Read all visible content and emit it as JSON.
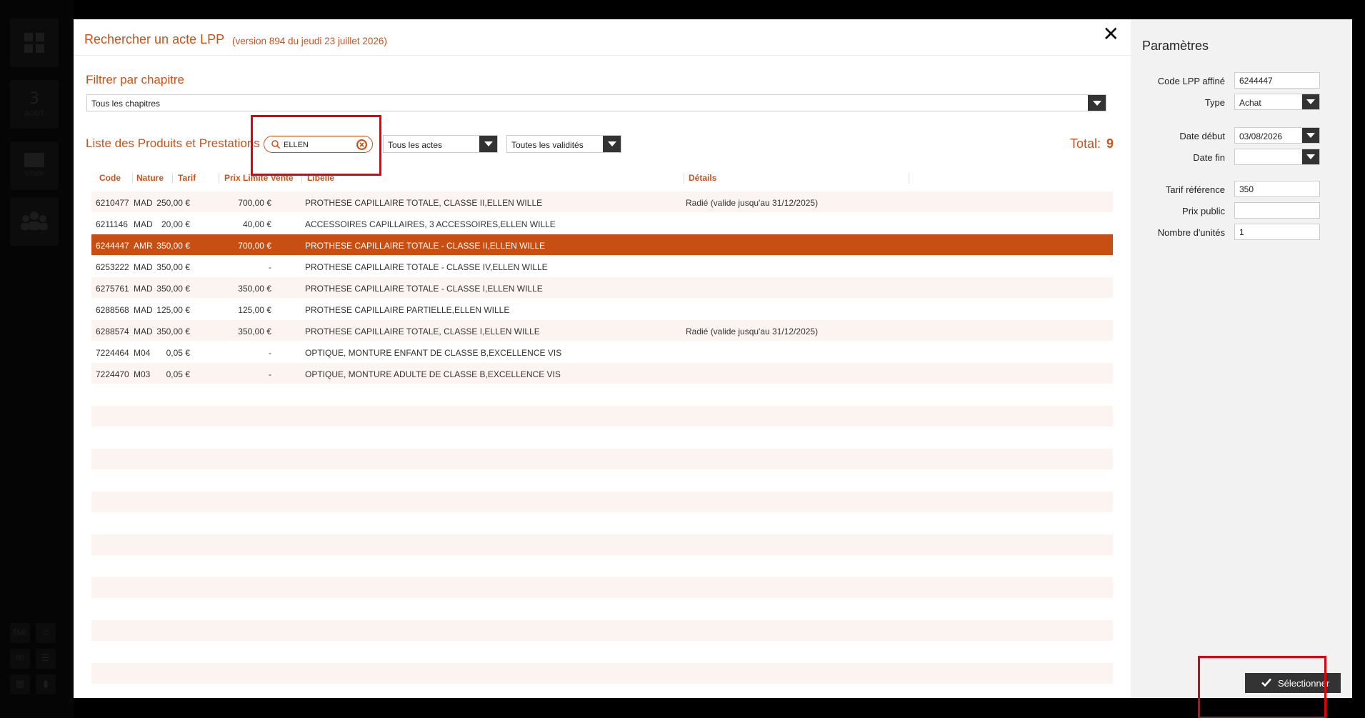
{
  "background": {
    "tile_text": "3",
    "tile_subtext": "AOÛT",
    "tile_vitale": "vitale",
    "small_fse": "fse"
  },
  "dialog": {
    "title": "Rechercher un acte LPP",
    "version": "(version 894 du jeudi 23 juillet 2026)",
    "filter_title": "Filtrer par chapitre",
    "chapter_value": "Tous les chapitres",
    "list_title": "Liste des Produits et Prestations",
    "search_value": "ELLEN",
    "actes_value": "Tous les actes",
    "validity_value": "Toutes les validités",
    "total_label": "Total:",
    "total_value": "9"
  },
  "table": {
    "headers": {
      "code": "Code",
      "nature": "Nature",
      "tarif": "Tarif",
      "prix": "Prix Limite Vente",
      "libelle": "Libellé",
      "details": "Détails"
    },
    "rows": [
      {
        "code": "6210477",
        "nature": "MAD",
        "tarif": "250,00 €",
        "prix": "700,00 €",
        "libelle": "PROTHESE CAPILLAIRE TOTALE, CLASSE II,ELLEN WILLE",
        "details": "Radié (valide jusqu'au 31/12/2025)"
      },
      {
        "code": "6211146",
        "nature": "MAD",
        "tarif": "20,00 €",
        "prix": "40,00 €",
        "libelle": "ACCESSOIRES CAPILLAIRES, 3 ACCESSOIRES,ELLEN WILLE",
        "details": ""
      },
      {
        "code": "6244447",
        "nature": "AMR",
        "tarif": "350,00 €",
        "prix": "700,00 €",
        "libelle": "PROTHESE CAPILLAIRE TOTALE - CLASSE II,ELLEN WILLE",
        "details": ""
      },
      {
        "code": "6253222",
        "nature": "MAD",
        "tarif": "350,00 €",
        "prix": "-",
        "libelle": "PROTHESE CAPILLAIRE TOTALE - CLASSE IV,ELLEN WILLE",
        "details": ""
      },
      {
        "code": "6275761",
        "nature": "MAD",
        "tarif": "350,00 €",
        "prix": "350,00 €",
        "libelle": "PROTHESE CAPILLAIRE TOTALE - CLASSE I,ELLEN WILLE",
        "details": ""
      },
      {
        "code": "6288568",
        "nature": "MAD",
        "tarif": "125,00 €",
        "prix": "125,00 €",
        "libelle": "PROTHESE CAPILLAIRE PARTIELLE,ELLEN WILLE",
        "details": ""
      },
      {
        "code": "6288574",
        "nature": "MAD",
        "tarif": "350,00 €",
        "prix": "350,00 €",
        "libelle": "PROTHESE CAPILLAIRE TOTALE, CLASSE I,ELLEN WILLE",
        "details": "Radié (valide jusqu'au 31/12/2025)"
      },
      {
        "code": "7224464",
        "nature": "M04",
        "tarif": "0,05 €",
        "prix": "-",
        "libelle": "OPTIQUE, MONTURE ENFANT DE CLASSE B,EXCELLENCE VIS",
        "details": ""
      },
      {
        "code": "7224470",
        "nature": "M03",
        "tarif": "0,05 €",
        "prix": "-",
        "libelle": "OPTIQUE, MONTURE ADULTE DE CLASSE B,EXCELLENCE VIS",
        "details": ""
      }
    ],
    "selected_row": 2
  },
  "panel": {
    "title": "Paramètres",
    "code_lpp_label": "Code LPP affiné",
    "code_lpp_value": "6244447",
    "type_label": "Type",
    "type_value": "Achat",
    "date_debut_label": "Date début",
    "date_debut_value": "03/08/2026",
    "date_fin_label": "Date fin",
    "date_fin_value": "",
    "tarif_ref_label": "Tarif référence",
    "tarif_ref_value": "350",
    "prix_public_label": "Prix public",
    "prix_public_value": "",
    "nb_unites_label": "Nombre d'unités",
    "nb_unites_value": "1",
    "select_button": "Sélectionner"
  },
  "colors": {
    "accent": "#c8531a",
    "selected_row": "#c84f14",
    "highlight_box": "#e0000f"
  }
}
